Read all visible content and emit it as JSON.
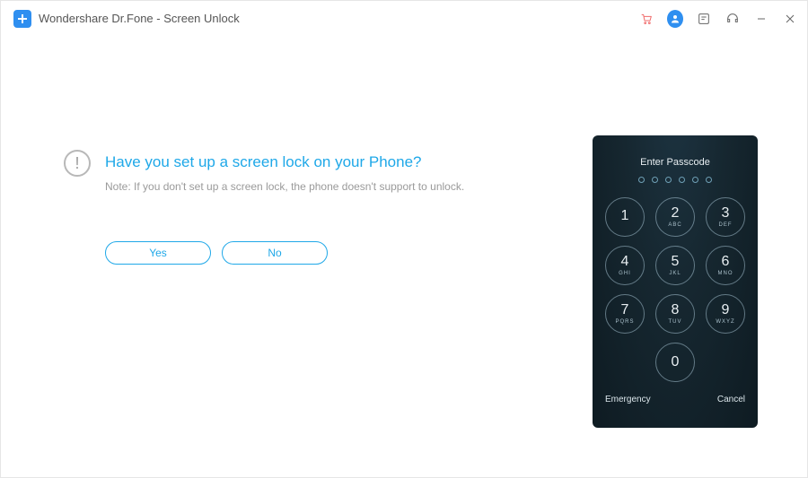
{
  "title": "Wondershare Dr.Fone - Screen Unlock",
  "main": {
    "question": "Have you set up a screen lock on your Phone?",
    "note": "Note: If you don't set up a screen lock, the phone doesn't support to unlock.",
    "yes": "Yes",
    "no": "No"
  },
  "phone": {
    "label": "Enter Passcode",
    "keys": [
      {
        "n": "1",
        "l": ""
      },
      {
        "n": "2",
        "l": "ABC"
      },
      {
        "n": "3",
        "l": "DEF"
      },
      {
        "n": "4",
        "l": "GHI"
      },
      {
        "n": "5",
        "l": "JKL"
      },
      {
        "n": "6",
        "l": "MNO"
      },
      {
        "n": "7",
        "l": "PQRS"
      },
      {
        "n": "8",
        "l": "TUV"
      },
      {
        "n": "9",
        "l": "WXYZ"
      }
    ],
    "zero": "0",
    "emergency": "Emergency",
    "cancel": "Cancel"
  }
}
